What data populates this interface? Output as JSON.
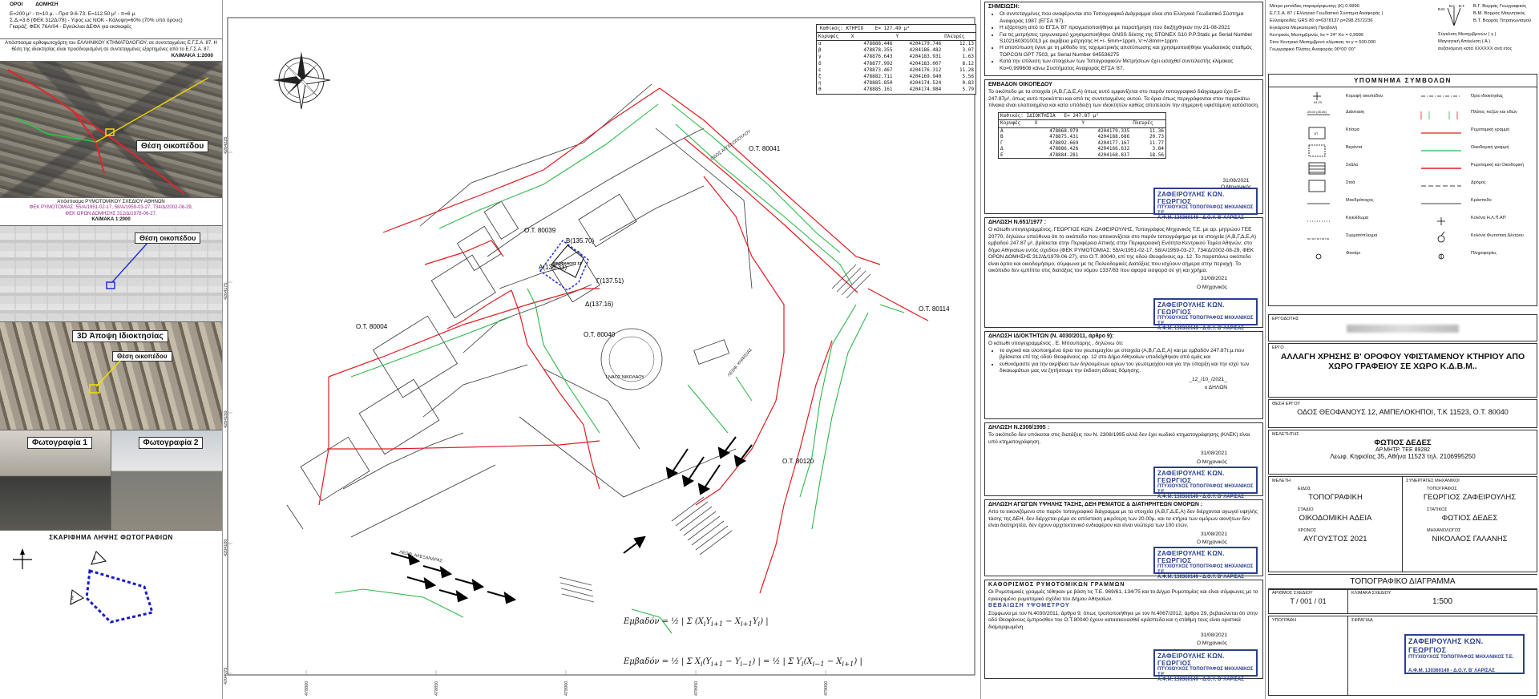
{
  "left": {
    "header_terms": "ΟΡΟΙ",
    "header_building": "ΔΟΜΗΣΗ",
    "header_lines": [
      "Ε=200 μ² - π=10 μ. - Πρσ 9-6-73: Ε=112.50 μ² - π=6 μ.",
      "Σ.Δ.=3.6 (ΦΕΚ 312Δ/78) - Υψος ως ΝΟΚ - Κάλυψη=60% (70% υπό όρους)",
      "Γκαράζ: ΦΕΚ 76Α/04 - Εγκύκλιοι ΔΕΦΑ για εκσκαφές"
    ],
    "ortho_caption": "Απόσπασμα ορθοφωτοχάρτη του ΕΛΛΗΝΙΚΟΥ ΚΤΗΜΑΤΟΛΟΓΙΟΥ, σε συντεταγμένες Ε.Γ.Σ.Α. 87. Η θέση της ιδιοκτησίας είναι προσδιορισμένη σε συντεταγμένες εξαρτημένες από το Ε.Γ.Σ.Α. 87.",
    "ortho_scale": "ΚΛΙΜΑΚΑ 1:2000",
    "ortho_label": "Θέση οικοπέδου",
    "plan_caption": "Απόσπασμα ΡΥΜΟΤΟΜΙΚΟΥ ΣΧΕΔΙΟΥ ΑΘΗΝΩΝ",
    "plan_fek1": "ΦΕΚ ΡΥΜΟΤΟΜΙΑΣ: 55/Α/1951-02-17, 58/Α/1959-03-27, 734/Δ/2002-08-29,",
    "plan_fek2": "ΦΕΚ ΟΡΩΝ ΔΟΜΗΣΗΣ 312/Δ/1978-06-27,",
    "plan_scale": "ΚΛΙΜΑΚΑ 1:2000",
    "plan_label": "Θέση οικοπέδου",
    "view3d_label": "3D Άποψη Ιδιοκτησίας",
    "view3d_marker": "Θέση οικοπέδου",
    "photo1_label": "Φωτογραφία 1",
    "photo2_label": "Φωτογραφία 2",
    "sketch_title": "ΣΚΑΡΙΦΗΜΑ ΛΗΨΗΣ ΦΩΤΟΓΡΑΦΙΩΝ",
    "sketch_n1": "1",
    "sketch_n2": "2"
  },
  "drawing": {
    "coord_table": {
      "title": "Καθικός: ΚΤΗΡΙΟ",
      "area": "E= 127.49 μ²",
      "headers": [
        "Κορυφές",
        "X",
        "Y",
        "Πλευρές"
      ],
      "rows": [
        [
          "α",
          "478888.446",
          "4204179.746",
          "12.13"
        ],
        [
          "β",
          "478878.355",
          "4204186.482",
          "3.07"
        ],
        [
          "γ",
          "478876.643",
          "4204183.931",
          "1.63"
        ],
        [
          "δ",
          "478877.992",
          "4204183.007",
          "8.12"
        ],
        [
          "ε",
          "478873.467",
          "4204176.312",
          "11.28"
        ],
        [
          "ζ",
          "478882.711",
          "4204169.940",
          "5.56"
        ],
        [
          "η",
          "478885.850",
          "4204174.524",
          "0.83"
        ],
        [
          "θ",
          "478885.161",
          "4204174.984",
          "5.79"
        ]
      ]
    },
    "blocks": [
      "Ο.Τ. 80041",
      "Ο.Τ. 80039",
      "Ο.Τ. 80004",
      "Ο.Τ. 80040",
      "Ο.Τ. 80114",
      "Ο.Τ. 80120"
    ],
    "streets": [
      "ΟΔΟΣ ΑΓΓΕΛΟΠΟΥΛΟΥ",
      "ΛΕΩΦ. ΚΗΦΙΣΙΑΣ",
      "ΛΕΩΦ. ΑΛΕΞΑΝΔΡΑΣ"
    ],
    "church": "Ι.ΝΑΟΣ ΝΙΚΟΛΑΟΥ",
    "spot_heights": [
      "Β(135.70)",
      "Α(135.33)",
      "Γ(137.51)",
      "Δ(137.16)"
    ],
    "subject": "ΘΕΟΦΑΝΟΥΣ 12",
    "formula_label": "Εμβαδόν",
    "y_axis": [
      "4204225",
      "4204200",
      "4204175",
      "4204150",
      "4204125",
      "4204100",
      "4204075"
    ],
    "x_axis": [
      "478775",
      "478800",
      "478825",
      "478850",
      "478875",
      "478900",
      "478925",
      "478950",
      "478975",
      "479000"
    ]
  },
  "notes": {
    "remarks_title": "ΣΗΜΕΙΩΣΗ:",
    "remarks": [
      "Οι συντεταγμένες που αναφέρονται στο Τοπογραφικό Διάγραμμα είναι στο Ελληνικό Γεωδαιτικό Σύστημα Αναφοράς 1987 (ΕΓΣΑ '87).",
      "Η εξάρτηση από το ΕΓΣΑ '87 πραγματοποιήθηκε με παρατήρηση που διεξήχθηκαν την 21-08-2021",
      "Για τις μετρήσεις τριγωνισμού χρησιμοποιήθηκε GNSS δέκτης της STONEX S10 P.P.Static με Serial Number S1021603010013 με ακρίβεια μέτρησης H:+/- 5mm+1ppm, V:+/-8mm+1ppm",
      "Η αποτύπωση έγινε με τη μέθοδο της ταχυμετρικής αποτύπωσης και χρησιμοποιήθηκε γεωδαιτικός σταθμός TOPCON GPT 7503, με Serial Number 645536275",
      "Κατά την επίλυση των στοιχείων των Τοπογραφικών Μετρήσεων έχει εισαχθεί συντελεστής κλίμακας Ko=0,999608 κάνω Συστήματος Αναφοράς ΕΓΣΑ '87."
    ],
    "area_title": "ΕΜΒΑΔΟΝ ΟΙΚΟΠΕΔΟΥ",
    "area_text": "Το οικόπεδο με τα στοιχεία (Α,Β,Γ,Δ,Ε,Α) όπως αυτό εμφανίζεται στο παρόν τοπογραφικό διάγραμμα έχει Ε= 247.87μ², όπως αυτό προκύπτει και από τις συντεταγμένες αυτού. Τα όρια όπως περιγράφονται στον παρακάτω πίνακα είναι υλοποιημένα και κατα υπόδειξη των ιδιοκτητών καθώς αποτελούν την σημερινή υφιστάμενη κατάσταση.",
    "prop_table": {
      "title": "Καθικός: ΙΔΙΟΚΤΗΣΙΑ",
      "area": "E= 247.87 μ²",
      "headers": [
        "Κορυφές",
        "X",
        "Y",
        "Πλευρές"
      ],
      "rows": [
        [
          "Α",
          "478868.979",
          "4204179.335",
          "11.36"
        ],
        [
          "Β",
          "478875.431",
          "4204188.686",
          "20.73"
        ],
        [
          "Γ",
          "478892.669",
          "4204177.167",
          "11.77"
        ],
        [
          "Δ",
          "478886.426",
          "4204166.632",
          "3.84"
        ],
        [
          "Ε",
          "478884.281",
          "4204168.837",
          "18.56"
        ]
      ]
    },
    "date_1": "31/08/2021",
    "engineer": "Ο Μηχανικός",
    "decl_651_title": "ΔΗΛΩΣΗ Ν.651/1977 :",
    "decl_651_text": "Ο κάτωθι υπογεγραμμένος, ΓΕΩΡΓΙΟΣ ΚΩΝ. ΖΑΦΕΙΡΟΥΛΗΣ, Τοπογράφος Μηχανικός Τ.Ε. με αρ. μητρώου ΤΕΕ 20770, δηλώνω υπεύθυνα ότι το οικόπεδο που απεικονίζεται στο παρόν τοπογράφημα με τα στοιχεία (Α,Β,Γ,Δ,Ε,Α) εμβαδού 247.87 μ², βρίσκεται στην Περιφέρεια Αττικής στην Περιφερειακή Ενότητα Κεντρικού Τομέα Αθηνών, στο δήμο Αθηναίων εντός σχεδίου (ΦΕΚ ΡΥΜΟΤΟΜΙΑΣ: 55/Α/1951-02-17, 58/Α/1959-03-27, 734/Δ/2002-08-29, ΦΕΚ ΟΡΩΝ ΔΟΜΗΣΗΣ:312/Δ/1978-06-27), στο Ο.Τ. 80040, επί της οδού Θεοφάνους αρ. 12. Το παραπάνω οικόπεδο είναι άρτιο και οικοδομήσιμο, σύμφωνα με τις Πολεοδομικές Διατάξεις που ισχύουν σήμερα στην περιοχή. Το οικόπεδο δεν εμπίπτει στις διατάξεις του νόμου 1337/83 που αφορά εισφορά σε γη και χρήμα.",
    "decl_owner_title": "ΔΗΛΩΣΗ ΙΔΙΟΚΤΗΤΩΝ (Ν. 4030/2011, άρθρο 9):",
    "decl_owner_intro": "Ο κάτωθι υπογεγραμμένος  . Ε. Μπουπαρης , δηλώνω ότι:",
    "decl_owner_items": [
      "το αγρικό και υλοποιημένα όρια του γεωτεμαχίου με στοιχεία (Α,Β,Γ,Δ,Ε,Α) και με εμβαδόν 247.87τ.μ.που βρίσκεται επί της οδού Θεοφάνους αρ. 12 στο Δήμο Αθηναίων υποδείχθηκαν από εμάς και",
      "ευθυνόμαστε για την ακρίβεια των δηλουμένων ορίων του γεωτεμαχίου και για την ύπαρξη και την ισχύ των δικαιωμάτων μας να ζητήσουμε την έκδοση άδειας δόμησης."
    ],
    "date_owner": "_12_/10_/2021_",
    "owner_sig": "ο ΔΗΛΩΝ",
    "decl_2308_title": "ΔΗΛΩΣΗ Ν.2308/1995 :",
    "decl_2308_text": "Το οικόπεδο δεν υπόκειται στις διατάξεις του Ν. 2308/1995 αλλά δεν έχει κωδικό κτηματογράφησης (ΚΑΕΚ) είναι υπό κτηματογράφηση.",
    "decl_flow_title": "ΔΗΛΩΣΗ ΑΓΩΓΩΝ ΥΨΗΛΗΣ ΤΑΣΗΣ, ΔΕΗ ΡΕΜΑΤΟΣ & ΔΙΑΤΗΡΗΤΕΩΝ ΟΜΟΡΩΝ :",
    "decl_flow_text": "Απο το εικονιζόμενο στο παρόν τοπογραφικό διάγραμμα με τα στοιχεία (Α,Β,Γ,Δ,Ε,Α) δεν διέρχονται αγωγοί υψηλής τάσης της ΔΕΗ, δεν διέρχεται ρέμα σε απόσταση μικρότερη των 20.00μ. και τα κτήρια των ομόρων ακινήτων δεν είναι διατηρητέα, δεν έχουν αρχιτεκτονικό ενδιαφέρον και είναι νεώτερα των 100 ετών.",
    "rym_title": "ΚΑΘΟΡΙΣΜΟΣ ΡΥΜΟΤΟΜΙΚΩΝ ΓΡΑΜΜΩΝ",
    "rym_text": "Οι Ρυμοτομικές γραμμές τέθηκαν με βάση τις Τ.Ε. 969/61, 134/75 και το Δ/γμα Ρυμοτομίας και είναι σύμφωνες με το εγκεκριμένο ρυμοτομικό σχέδιο του Δήμου Αθηναίων.",
    "ypso_title": "ΒΕΒΑΙΩΣΗ ΥΨΟΜΕΤΡΟΥ",
    "ypso_text": "Σύμφωνα με τον Ν.4030/2011, άρθρο 9, όπως τροποποιήθηκε με τον Ν.4067/2012, άρθρο 29, βεβαιώνεται ότι στην οδό Θεοφάνους έμπροσθεν του Ο.Τ.80040 έχουν κατασκευασθεί κράσπεδα και η στάθμη τους είναι οριστικά διαμορφωμένη.",
    "stamp_line1": "ΖΑΦΕΙΡΟΥΛΗΣ ΚΩΝ. ΓΕΩΡΓΙΟΣ",
    "stamp_line2": "ΠΤΥΧΙΟΥΧΟΣ ΤΟΠΟΓΡΑΦΟΣ ΜΗΧΑΝΙΚΟΣ Τ.Ε.",
    "stamp_line3": "Α.Φ.Μ. 130360149 - Δ.Ο.Υ. Β' ΛΑΡΙΣΑΣ"
  },
  "titleblock": {
    "meta_lines": [
      "Μέτρο μονάδας παραμόρφωσης (Κ)                0.9996",
      "Ε.Γ.Σ.Α. 87 ( Ελληνικό Γεωδαιτικό Σύστημα Αναφοράς )",
      "Ελλειψοειδές    GRS 80 α=6378137    ρ=298.2572236",
      "Εγκάρσια Μερκατορική Προβολή",
      "Κεντρικός Μεσημβρινός λο = 24°       Κο = 0,9996",
      "Στον Κεντρικό Μεσημβρινό κλίμακας το y = 500.000",
      "Γεωγραφικό Πλάτος Αναφοράς 00°00' 00\""
    ],
    "meta_right": [
      "Β.Γ.  Βορράς Γεωγραφικός",
      "Β.Μ.  Βορράς Μαγνητικός",
      "Β.Τ.  Βορράς Τετραγωνισμού",
      "Σύγκλιση Μεσημβρινών ( γ )",
      "Μαγνητική Απόκλιση   ( Α )",
      "αυξανόμενη κατά  XXXXXX  ανά έτος"
    ],
    "meta_bg": "Β.Γ.",
    "meta_bt": "Β.Τ.",
    "meta_bm": "Β.Μ.",
    "legend_title": "ΥΠΟΜΝΗΜΑ ΣΥΜΒΟΛΩΝ",
    "legend_spot": "94.23",
    "legend_dim": "25.00 (25.36)",
    "legend_kt": "1Π",
    "legend_items": [
      [
        "Κορυφή οικοπέδου",
        "Όριο ιδιοκτησίας"
      ],
      [
        "Διάσταση",
        "Πλάτος πεζών και οδών"
      ],
      [
        "Κτίσμα",
        "Ρυμοτομική γραμμή"
      ],
      [
        "Βεράντα",
        "Οικοδομική γραμμή"
      ],
      [
        "Σκάλα",
        "Ρυμοτομική και Οικοδομική"
      ],
      [
        "Στοά",
        "Δρόμος"
      ],
      [
        "Μανδρότοιχος",
        "Κράσπεδο"
      ],
      [
        "Κιγκλίδωμα",
        "Κολόνα Η.Λ.Π.ΑΠ"
      ],
      [
        "Συρματόπλεγμα",
        "Κολόνα Φωτιστική Δέντρου"
      ],
      [
        "Φανάρι",
        "Πληροφορίες"
      ]
    ],
    "ergodotis_lbl": "ΕΡΓΟΔΟΤΗΣ",
    "ergo_lbl": "ΕΡΓΟ",
    "ergo_title": "ΑΛΛΑΓΗ ΧΡΗΣΗΣ Β' ΟΡΟΦΟΥ ΥΦΙΣΤΑΜΕΝΟΥ ΚΤΗΡΙΟΥ ΑΠΟ ΧΩΡΟ ΓΡΑΦΕΙΟΥ ΣΕ ΧΩΡΟ Κ.Δ.Β.Μ..",
    "thesi_lbl": "ΘΕΣΗ ΕΡΓΟΥ",
    "thesi": "ΟΔΟΣ ΘΕΟΦΑΝΟΥΣ 12, ΑΜΠΕΛΟΚΗΠΟΙ, Τ.Κ 11523, Ο.Τ. 80040",
    "meletitis_lbl": "ΜΕΛΕΤΗΤΗΣ",
    "meletitis": "ΦΩΤΙΟΣ   ΔΕΔΕΣ",
    "meletitis_am": "ΑΡ.ΜΗΤΡ. ΤΕΕ 89282",
    "meletitis_addr": "Λεωφ. Κηφισίας 35, Αθήνα 11523 τηλ. 2106995250",
    "meleti_lbl": "ΜΕΛΕΤΗ",
    "synergates_lbl": "ΣΥΝΕΡΓΑΤΕΣ ΜΗΧΑΝΙΚΟΙ",
    "eidos_lbl": "ΕΙΔΟΣ",
    "eidos": "ΤΟΠΟΓΡΑΦΙΚΗ",
    "topografos_lbl": "ΤΟΠΟΓΡΑΦΟΣ",
    "topografos": "ΓΕΩΡΓΙΟΣ ΖΑΦΕΙΡΟΥΛΗΣ",
    "stadio_lbl": "ΣΤΑΔΙΟ",
    "stadio": "ΟΙΚΟΔΟΜΙΚΗ ΑΔΕΙΑ",
    "statikos_lbl": "ΣΤΑΤΙΚΟΣ",
    "statikos": "ΦΩΤΙΟΣ ΔΕΔΕΣ",
    "xronos_lbl": "ΧΡΟΝΟΣ",
    "xronos": "ΑΥΓΟΥΣΤΟΣ 2021",
    "mixanologos_lbl": "ΜΗΧΑΝΟΛΟΓΟΣ",
    "mixanologos": "ΝΙΚΟΛΑΟΣ ΓΑΛΑΝΗΣ",
    "drawing_title": "ΤΟΠΟΓΡΑΦΙΚΟ ΔΙΑΓΡΑΜΜΑ",
    "sheet_no_lbl": "ΑΡΙΘΜΟΣ ΣΧΕΔΙΟΥ",
    "sheet_no": "Τ / 001 / 01",
    "scale_lbl": "ΚΛΙΜΑΚΑ ΣΧΕΔΙΟΥ",
    "scale": "1:500",
    "ypografi_lbl": "ΥΠΟΓΡΑΦΗ",
    "sfragida_lbl": "ΣΦΡΑΓΙΔΑ"
  }
}
